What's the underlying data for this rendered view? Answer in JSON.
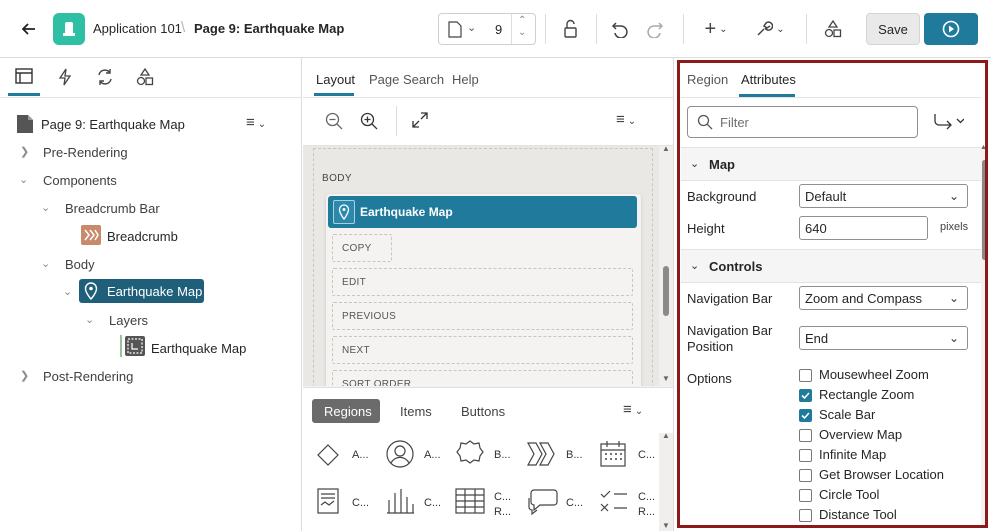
{
  "header": {
    "app_name": "Application 101",
    "page_title": "Page 9: Earthquake Map",
    "page_number": "9",
    "save_label": "Save"
  },
  "tree": {
    "root": "Page 9: Earthquake Map",
    "items": [
      "Pre-Rendering",
      "Components",
      "Breadcrumb Bar",
      "Breadcrumb",
      "Body",
      "Earthquake Map",
      "Layers",
      "Earthquake Map",
      "Post-Rendering"
    ]
  },
  "middle": {
    "tabs": [
      "Layout",
      "Page Search",
      "Help"
    ],
    "body_label": "BODY",
    "region_title": "Earthquake Map",
    "slots": [
      "COPY",
      "EDIT",
      "PREVIOUS",
      "NEXT",
      "SORT ORDER"
    ],
    "gallery_tabs": [
      "Regions",
      "Items",
      "Buttons"
    ],
    "gallery_items": [
      "A...",
      "A...",
      "B...",
      "B...",
      "C...",
      "C...",
      "C...",
      "C...\nR...",
      "C...",
      "C...\nR..."
    ]
  },
  "right": {
    "tabs": [
      "Region",
      "Attributes"
    ],
    "filter_placeholder": "Filter",
    "section_map": "Map",
    "background_label": "Background",
    "background_value": "Default",
    "height_label": "Height",
    "height_value": "640",
    "height_unit": "pixels",
    "section_controls": "Controls",
    "nav_bar_label": "Navigation Bar",
    "nav_bar_value": "Zoom and Compass",
    "nav_bar_pos_label": "Navigation Bar Position",
    "nav_bar_pos_value": "End",
    "options_label": "Options",
    "options": [
      {
        "label": "Mousewheel Zoom",
        "checked": false
      },
      {
        "label": "Rectangle Zoom",
        "checked": true
      },
      {
        "label": "Scale Bar",
        "checked": true
      },
      {
        "label": "Overview Map",
        "checked": false
      },
      {
        "label": "Infinite Map",
        "checked": false
      },
      {
        "label": "Get Browser Location",
        "checked": false
      },
      {
        "label": "Circle Tool",
        "checked": false
      },
      {
        "label": "Distance Tool",
        "checked": false
      }
    ]
  },
  "colors": {
    "accent": "#1f7a9c",
    "selected": "#1f5f7a",
    "frame": "#8c1a1a",
    "app_icon": "#2ebfa5"
  }
}
